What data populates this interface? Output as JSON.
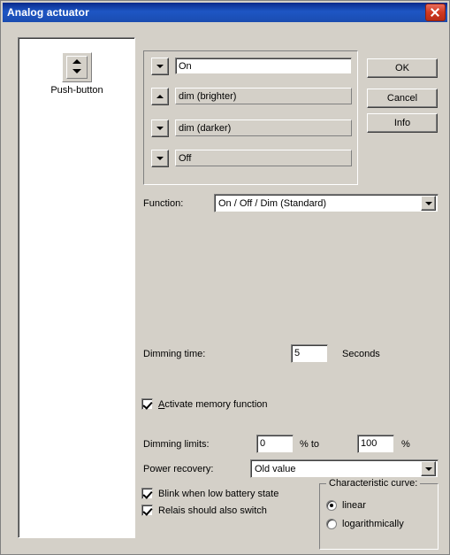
{
  "window": {
    "title": "Analog actuator",
    "close_icon": "close-icon"
  },
  "device_panel": {
    "item_label": "Push-button",
    "icon": "up-down-arrows-icon"
  },
  "action_rows": [
    {
      "button_icon": "arrow-down-icon",
      "value": "On"
    },
    {
      "button_icon": "arrow-up-icon",
      "value": "dim (brighter)"
    },
    {
      "button_icon": "arrow-down-icon",
      "value": "dim (darker)"
    },
    {
      "button_icon": "arrow-down-icon",
      "value": "Off"
    }
  ],
  "buttons": {
    "ok": "OK",
    "cancel": "Cancel",
    "info": "Info"
  },
  "function": {
    "label": "Function:",
    "value": "On / Off / Dim (Standard)"
  },
  "dimming_time": {
    "label": "Dimming time:",
    "value": "5",
    "unit": "Seconds"
  },
  "memory": {
    "label": "Activate memory function",
    "checked": true
  },
  "dimming_limits": {
    "label": "Dimming limits:",
    "min": "0",
    "percent_to": "% to",
    "max": "100",
    "percent": "%"
  },
  "power_recovery": {
    "label": "Power recovery:",
    "value": "Old value"
  },
  "options": [
    {
      "label": "Blink when low battery state",
      "checked": true
    },
    {
      "label": "Relais should also switch",
      "checked": true
    }
  ],
  "characteristic_curve": {
    "title": "Characteristic curve:",
    "options": [
      {
        "label": "linear",
        "selected": true
      },
      {
        "label": "logarithmically",
        "selected": false
      }
    ]
  }
}
